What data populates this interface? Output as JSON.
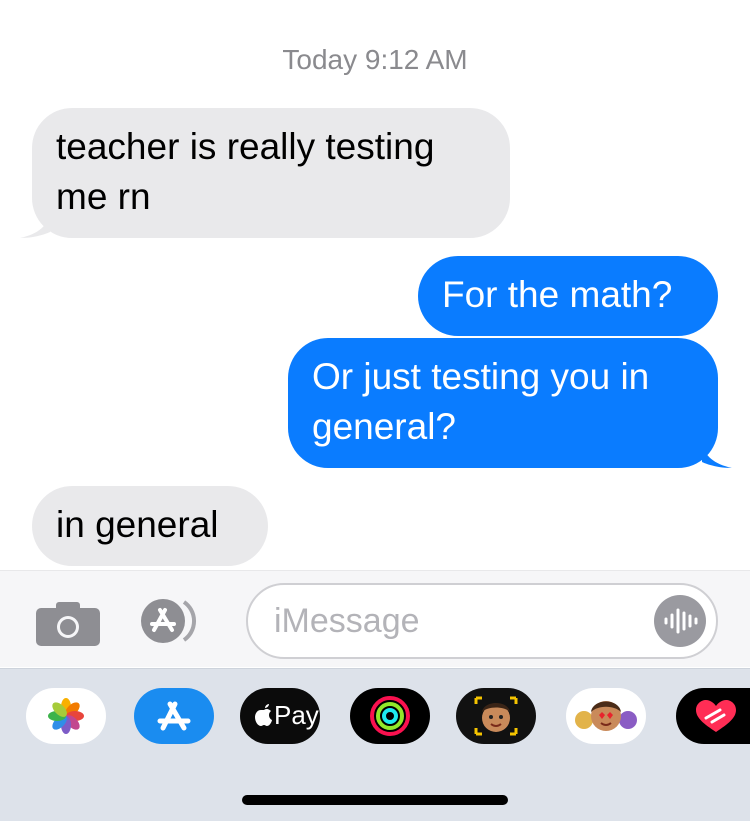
{
  "thread": {
    "timestamp": "Today 9:12 AM",
    "messages": [
      {
        "direction": "received",
        "lines": [
          "teacher is really testing",
          "me rn"
        ]
      },
      {
        "direction": "sent",
        "lines": [
          "For the math?"
        ]
      },
      {
        "direction": "sent",
        "lines": [
          "Or just testing you in",
          "general?"
        ]
      },
      {
        "direction": "received",
        "lines": [
          "in general"
        ]
      }
    ]
  },
  "composer": {
    "placeholder": "iMessage"
  },
  "app_drawer": {
    "apps": [
      {
        "name": "photos-app-icon"
      },
      {
        "name": "app-store-app-icon"
      },
      {
        "name": "apple-pay-app-icon",
        "label": "Pay"
      },
      {
        "name": "activity-app-icon"
      },
      {
        "name": "memoji-camera-app-icon"
      },
      {
        "name": "memoji-stickers-app-icon"
      },
      {
        "name": "digital-touch-app-icon"
      }
    ]
  },
  "colors": {
    "sent_bubble": "#0a7cff",
    "received_bubble": "#e9e9eb",
    "timestamp": "#8a8a8e",
    "drawer_background": "#dde2ea"
  }
}
